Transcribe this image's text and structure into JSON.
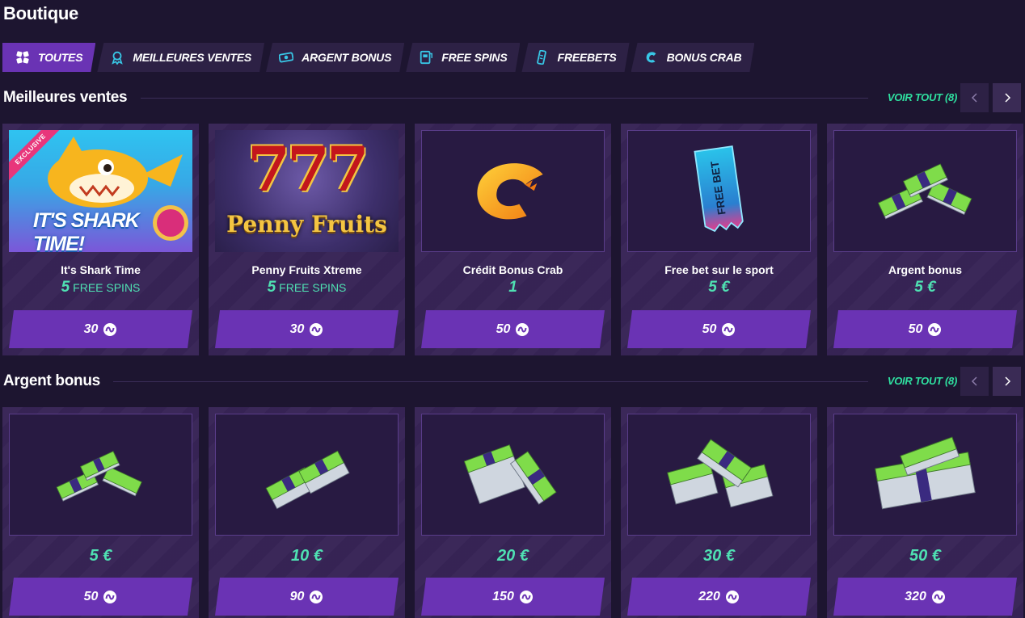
{
  "page": {
    "title": "Boutique"
  },
  "tabs": [
    {
      "label": "TOUTES",
      "icon": "dice-icon",
      "active": true
    },
    {
      "label": "MEILLEURES VENTES",
      "icon": "award-icon",
      "active": false
    },
    {
      "label": "ARGENT BONUS",
      "icon": "cash-icon",
      "active": false
    },
    {
      "label": "FREE SPINS",
      "icon": "slot-machine-icon",
      "active": false
    },
    {
      "label": "FREEBETS",
      "icon": "ticket-icon",
      "active": false
    },
    {
      "label": "BONUS CRAB",
      "icon": "crab-claw-icon",
      "active": false
    }
  ],
  "sections": {
    "best": {
      "title": "Meilleures ventes",
      "see_all": "VOIR TOUT (8)",
      "cards": [
        {
          "name": "It's Shark Time",
          "value": "5",
          "unit": "FREE SPINS",
          "price": "30",
          "image": "its-shark-time-game",
          "badge": "EXCLUSIVE",
          "art_text": "IT'S SHARK TIME!"
        },
        {
          "name": "Penny Fruits Xtreme",
          "value": "5",
          "unit": "FREE SPINS",
          "price": "30",
          "image": "penny-fruits-game",
          "art_text": "Penny Fruits",
          "art_sevens": "777"
        },
        {
          "name": "Crédit Bonus Crab",
          "value": "1",
          "unit": "",
          "price": "50",
          "image": "crab-claw"
        },
        {
          "name": "Free bet sur le sport",
          "value": "5 €",
          "unit": "",
          "price": "50",
          "image": "free-bet-ticket"
        },
        {
          "name": "Argent bonus",
          "value": "5 €",
          "unit": "",
          "price": "50",
          "image": "money-stacks-small"
        }
      ]
    },
    "bonus": {
      "title": "Argent bonus",
      "see_all": "VOIR TOUT (8)",
      "cards": [
        {
          "value": "5 €",
          "price": "50",
          "image": "money-stacks-1"
        },
        {
          "value": "10 €",
          "price": "90",
          "image": "money-stacks-2"
        },
        {
          "value": "20 €",
          "price": "150",
          "image": "money-stacks-3"
        },
        {
          "value": "30 €",
          "price": "220",
          "image": "money-stacks-4"
        },
        {
          "value": "50 €",
          "price": "320",
          "image": "money-stacks-5"
        }
      ]
    }
  },
  "colors": {
    "background": "#1d1530",
    "accent": "#6a33b4",
    "value": "#4fe0b2",
    "link": "#2fe0a0"
  }
}
